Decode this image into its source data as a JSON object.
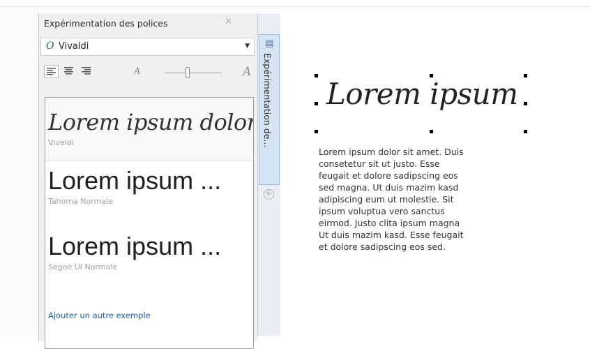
{
  "docker": {
    "title": "Expérimentation des polices",
    "close_glyph": "×",
    "font_select": {
      "value": "Vivaldi",
      "icon": "opentype-font-icon",
      "icon_glyph": "O"
    },
    "toolbar": {
      "align_buttons": [
        "align-left-icon",
        "align-center-icon",
        "align-right-icon"
      ],
      "zoom_small_glyph": "A",
      "zoom_large_glyph": "A",
      "zoom_level": 0.4
    },
    "samples": [
      {
        "text": "Lorem ipsum dolor s...",
        "font_name": "Vivaldi"
      },
      {
        "text": "Lorem ipsum ...",
        "font_name": "Tahoma Normale"
      },
      {
        "text": "Lorem ipsum ...",
        "font_name": "Segoe UI Normale"
      }
    ],
    "add_sample_link": "Ajouter un autre exemple"
  },
  "tab_strip": {
    "tab_label": "Expérimentation de...",
    "tab_icon": "font-playground-icon",
    "plus_glyph": "+"
  },
  "canvas": {
    "heading": "Lorem ipsum",
    "body_lines": [
      "Lorem ipsum dolor sit amet. Duis",
      "consetetur sit ut justo. Esse",
      "feugait et dolore sadipscing eos",
      "sed magna. Ut duis mazim kasd",
      "adipiscing eum ut molestie. Sit",
      "ipsum voluptua vero sanctus",
      "eirmod. Justo clita ipsum magna",
      "Ut duis mazim kasd. Esse feugait",
      "et dolore sadipscing eos sed."
    ]
  },
  "colors": {
    "link": "#1a5fb4",
    "tab_active": "#d6e5f5"
  }
}
